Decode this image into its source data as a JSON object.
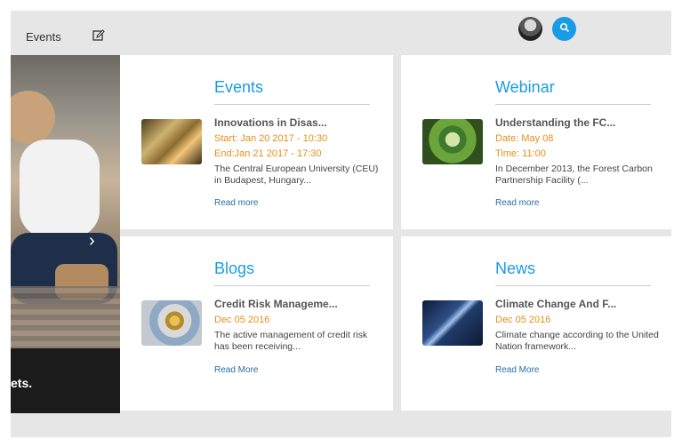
{
  "topbar": {
    "title": "Events"
  },
  "hero": {
    "caption": "ets."
  },
  "cards": [
    {
      "section": "Events",
      "headline": "Innovations in Disas...",
      "meta1": "Start: Jan 20 2017 - 10:30",
      "meta2": "End:Jan 21 2017 - 17:30",
      "description": "The Central European University (CEU) in Budapest, Hungary...",
      "link": "Read more"
    },
    {
      "section": "Webinar",
      "headline": "Understanding the FC...",
      "meta1": "Date: May 08",
      "meta2": "Time: 11:00",
      "description": "In December 2013, the Forest Carbon Partnership Facility (...",
      "link": "Read more"
    },
    {
      "section": "Blogs",
      "headline": "Credit Risk Manageme...",
      "meta1": "Dec 05 2016",
      "description": "The active management of credit risk has been receiving...",
      "link": "Read More"
    },
    {
      "section": "News",
      "headline": "Climate Change And F...",
      "meta1": "Dec 05 2016",
      "description": "Climate change according to the United Nation framework...",
      "link": "Read More"
    }
  ],
  "icons": {
    "edit": "edit-icon",
    "search": "search-icon",
    "avatar": "avatar",
    "chevron": "chevron-right-icon"
  },
  "colors": {
    "accent": "#1a9be6",
    "date": "#e58e1a",
    "link": "#2b6ea7",
    "frame": "#e6e6e6"
  }
}
